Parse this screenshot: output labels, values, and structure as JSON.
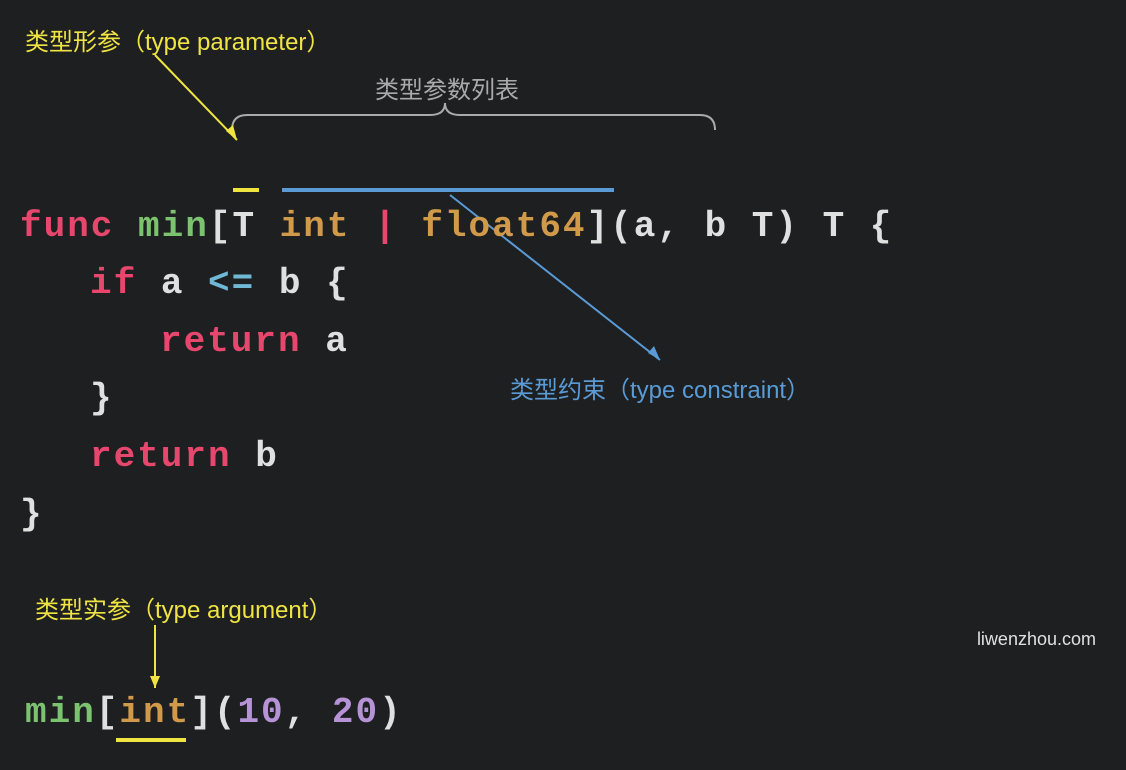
{
  "labels": {
    "typeParameter": "类型形参（type parameter）",
    "typeParamList": "类型参数列表",
    "typeConstraint": "类型约束（type constraint）",
    "typeArgument": "类型实参（type argument）"
  },
  "code": {
    "func": "func",
    "name": "min",
    "lbracket": "[",
    "genericT": "T",
    "typeInt": "int",
    "pipe": "|",
    "typeFloat": "float64",
    "rbracket": "]",
    "params": "(a, b T) T {",
    "ifKw": "if",
    "cond1": "a",
    "op": "<=",
    "cond2": "b {",
    "returnKw": "return",
    "retA": "a",
    "closeIf": "}",
    "retB": "b",
    "closeFunc": "}"
  },
  "call": {
    "name": "min",
    "lbracket": "[",
    "type": "int",
    "rbracket": "]",
    "lparen": "(",
    "arg1": "10",
    "comma": ", ",
    "arg2": "20",
    "rparen": ")"
  },
  "watermark": "liwenzhou.com"
}
